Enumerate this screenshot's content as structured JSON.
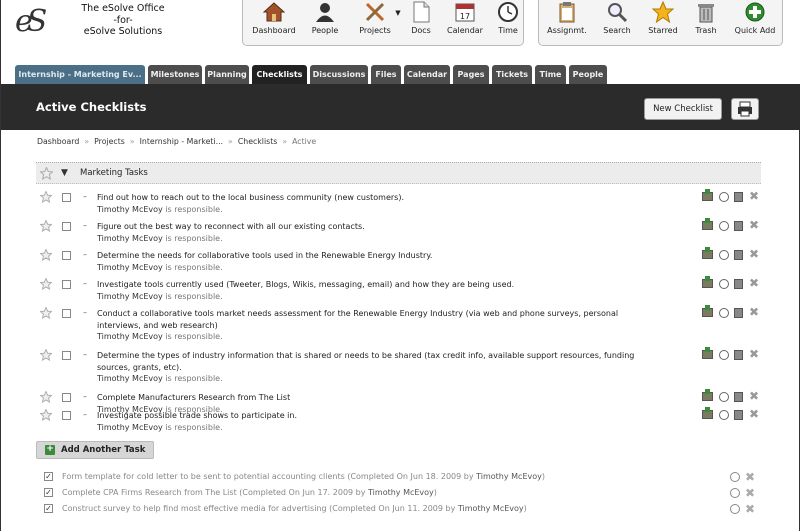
{
  "header": {
    "logo_text": "eS",
    "org_line1": "The eSolve Office",
    "org_line2": "-for-",
    "org_line3": "eSolve Solutions"
  },
  "nav_main": [
    {
      "label": "Dashboard",
      "icon": "house-icon"
    },
    {
      "label": "People",
      "icon": "people-icon"
    },
    {
      "label": "Projects",
      "icon": "tools-icon"
    },
    {
      "label": "Docs",
      "icon": "document-icon"
    },
    {
      "label": "Calendar",
      "icon": "calendar-icon"
    },
    {
      "label": "Time",
      "icon": "clock-icon"
    }
  ],
  "nav_user": [
    {
      "label": "Assignmt.",
      "icon": "clipboard-icon"
    },
    {
      "label": "Search",
      "icon": "magnifier-icon"
    },
    {
      "label": "Starred",
      "icon": "star-icon"
    },
    {
      "label": "Trash",
      "icon": "trash-icon"
    },
    {
      "label": "Quick Add",
      "icon": "plus-circle-icon"
    }
  ],
  "calendar_day": "17",
  "tabs": [
    {
      "label": "Internship - Marketing Ev...",
      "kind": "project"
    },
    {
      "label": "Milestones"
    },
    {
      "label": "Planning"
    },
    {
      "label": "Checklists",
      "active": true
    },
    {
      "label": "Discussions"
    },
    {
      "label": "Files"
    },
    {
      "label": "Calendar"
    },
    {
      "label": "Pages"
    },
    {
      "label": "Tickets"
    },
    {
      "label": "Time"
    },
    {
      "label": "People"
    }
  ],
  "page": {
    "title": "Active Checklists",
    "new_checklist_label": "New Checklist"
  },
  "breadcrumb": {
    "items": [
      "Dashboard",
      "Projects",
      "Internship - Marketi...",
      "Checklists"
    ],
    "current": "Active",
    "separator": "»"
  },
  "checklist": {
    "name": "Marketing Tasks",
    "responsible_suffix": "is responsible.",
    "tasks": [
      {
        "text": "Find out how to reach out to the local business community (new customers).",
        "assignee": "Timothy McEvoy"
      },
      {
        "text": "Figure out the best way to reconnect with all our existing contacts.",
        "assignee": "Timothy McEvoy"
      },
      {
        "text": "Determine the needs for collaborative tools used in the Renewable Energy Industry.",
        "assignee": "Timothy McEvoy"
      },
      {
        "text": "Investigate tools currently used (Tweeter, Blogs, Wikis, messaging, email) and how they are being used.",
        "assignee": "Timothy McEvoy"
      },
      {
        "text": "Conduct a collaborative tools market needs assessment for the Renewable Energy Industry (via web and phone surveys, personal interviews, and web research)",
        "assignee": "Timothy McEvoy"
      },
      {
        "text": "Determine the types of industry information that is shared or needs to be shared (tax credit info, available support resources, funding sources, grants, etc).",
        "assignee": "Timothy McEvoy"
      },
      {
        "text": "Complete Manufacturers Research from The List",
        "assignee": "Timothy McEvoy"
      },
      {
        "text": "Investigate possible trade shows to participate in.",
        "assignee": "Timothy McEvoy"
      }
    ],
    "add_task_label": "Add Another Task",
    "completed": [
      {
        "text": "Form template for cold letter to be sent to potential accounting clients (Completed On Jun 18. 2009 by",
        "who": "Timothy McEvoy",
        "tail": ")"
      },
      {
        "text": "Complete CPA Firms Research from The List (Completed On Jun 17. 2009 by",
        "who": "Timothy McEvoy",
        "tail": ")"
      },
      {
        "text": "Construct survey to help find most effective media for advertising (Completed On Jun 11. 2009 by",
        "who": "Timothy McEvoy",
        "tail": ")"
      }
    ]
  },
  "colors": {
    "title_bar": "#2b2b2b",
    "tab_bg": "#4d4d4d",
    "tab_active": "#222222",
    "tab_project": "#4a6f86",
    "accent_green": "#3c8a3c"
  }
}
